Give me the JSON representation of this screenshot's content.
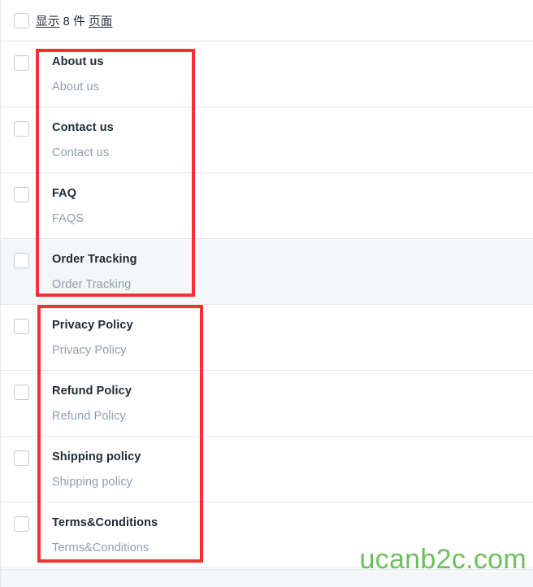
{
  "header": {
    "select_all_checkbox": "select-all",
    "summary_prefix": "显示",
    "summary_count": "8",
    "summary_unit": "件",
    "summary_noun": "页面",
    "summary_full": "显示 8 件 页面"
  },
  "rows": [
    {
      "title": "About us",
      "subtitle": "About us",
      "selected": false,
      "highlighted": false
    },
    {
      "title": "Contact us",
      "subtitle": "Contact us",
      "selected": false,
      "highlighted": false
    },
    {
      "title": "FAQ",
      "subtitle": "FAQS",
      "selected": false,
      "highlighted": false
    },
    {
      "title": "Order Tracking",
      "subtitle": "Order Tracking",
      "selected": false,
      "highlighted": true
    },
    {
      "title": "Privacy Policy",
      "subtitle": "Privacy Policy",
      "selected": false,
      "highlighted": false
    },
    {
      "title": "Refund Policy",
      "subtitle": "Refund Policy",
      "selected": false,
      "highlighted": false
    },
    {
      "title": "Shipping policy",
      "subtitle": "Shipping policy",
      "selected": false,
      "highlighted": false
    },
    {
      "title": "Terms&Conditions",
      "subtitle": "Terms&Conditions",
      "selected": false,
      "highlighted": false
    }
  ],
  "annotations": [
    {
      "name": "annotation-box-top",
      "color": "#ee3432"
    },
    {
      "name": "annotation-box-bottom",
      "color": "#ee3432"
    }
  ],
  "watermark": {
    "text": "ucanb2c.com",
    "color": "#6cbf5c"
  },
  "colors": {
    "title_text": "#212b36",
    "subtitle_text": "#919eab",
    "row_divider": "#e4e7ea",
    "header_divider": "#dfe3e8",
    "row_highlight_bg": "#f4f6f8",
    "checkbox_border": "#c4cdd5",
    "annotation_red": "#ee3432",
    "watermark_green": "#6cbf5c",
    "page_bg": "#ffffff"
  }
}
